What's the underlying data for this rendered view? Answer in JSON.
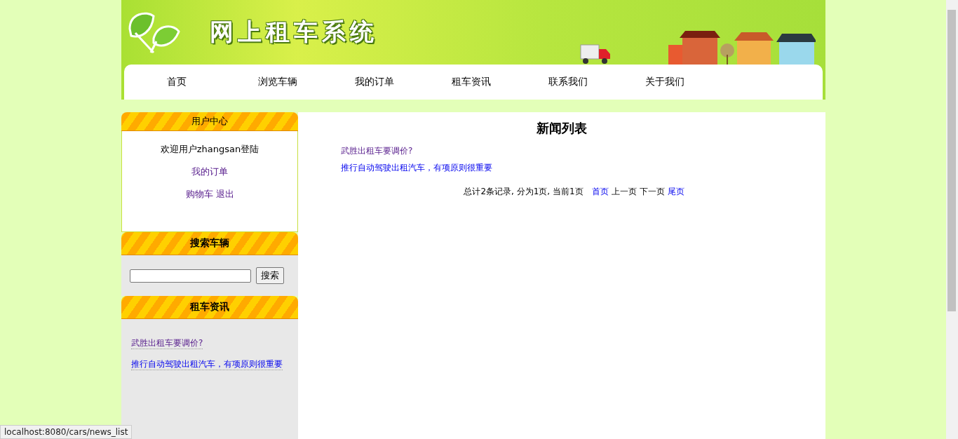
{
  "header": {
    "title": "网上租车系统"
  },
  "nav": [
    {
      "label": "首页"
    },
    {
      "label": "浏览车辆"
    },
    {
      "label": "我的订单"
    },
    {
      "label": "租车资讯"
    },
    {
      "label": "联系我们"
    },
    {
      "label": "关于我们"
    }
  ],
  "user_center": {
    "title": "用户中心",
    "welcome": "欢迎用户zhangsan登陆",
    "links": [
      [
        {
          "label": "我的订单"
        }
      ],
      [
        {
          "label": "购物车"
        },
        {
          "label": "退出"
        }
      ]
    ]
  },
  "search_panel": {
    "title": "搜索车辆",
    "button": "搜索"
  },
  "news_panel": {
    "title": "租车资讯",
    "items": [
      {
        "label": "武胜出租车要调价?",
        "visited": true
      },
      {
        "label": "推行自动驾驶出租汽车，有项原则很重要",
        "visited": false
      }
    ]
  },
  "main": {
    "title": "新闻列表",
    "items": [
      {
        "label": "武胜出租车要调价?",
        "visited": true
      },
      {
        "label": "推行自动驾驶出租汽车，有项原则很重要",
        "visited": false
      }
    ],
    "pagination": [
      {
        "kind": "text",
        "label": "总计2条记录, 分为1页, 当前1页"
      },
      {
        "kind": "link",
        "label": "首页"
      },
      {
        "kind": "text",
        "label": "上一页"
      },
      {
        "kind": "text",
        "label": "下一页"
      },
      {
        "kind": "link",
        "label": "尾页"
      }
    ]
  },
  "status_bar": "localhost:8080/cars/news_list"
}
